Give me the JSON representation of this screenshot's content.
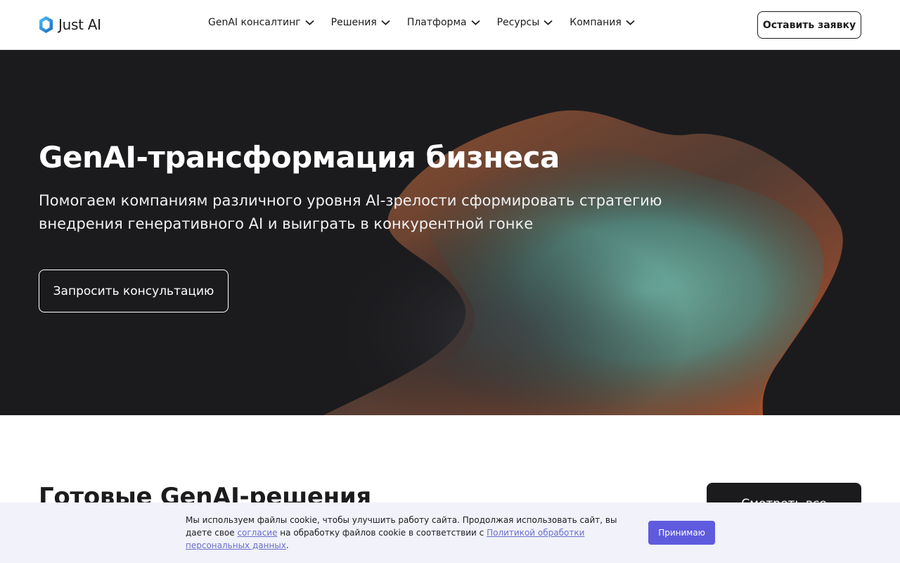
{
  "header": {
    "logo_text": "Just AI",
    "logo_icon": "just-ai-hexagon-logo",
    "nav": [
      {
        "label": "GenAI консалтинг",
        "icon": "chevron-down-icon"
      },
      {
        "label": "Решения",
        "icon": "chevron-down-icon"
      },
      {
        "label": "Платформа",
        "icon": "chevron-down-icon"
      },
      {
        "label": "Ресурсы",
        "icon": "chevron-down-icon"
      },
      {
        "label": "Компания",
        "icon": "chevron-down-icon"
      }
    ],
    "cta_label": "Оставить заявку"
  },
  "hero": {
    "title": "GenAI-трансформация бизнеса",
    "subtitle": "Помогаем компаниям различного уровня AI-зрелости сформировать стратегию внедрения генеративного AI и выиграть в конкурентной гонке",
    "button_label": "Запросить консультацию",
    "background_color": "#1b1b1e"
  },
  "section": {
    "title": "Готовые GenAI-решения",
    "see_all_label": "Смотреть все"
  },
  "cookie": {
    "text_before": "Мы используем файлы cookie, чтобы улучшить работу сайта. Продолжая использовать сайт, вы даете свое ",
    "consent_link": "согласие",
    "text_middle": " на обработку файлов cookie в соответствии с ",
    "policy_link": "Политикой обработки персональных данных",
    "text_after": ".",
    "accept_label": "Принимаю",
    "accent_color": "#5f5bde"
  }
}
